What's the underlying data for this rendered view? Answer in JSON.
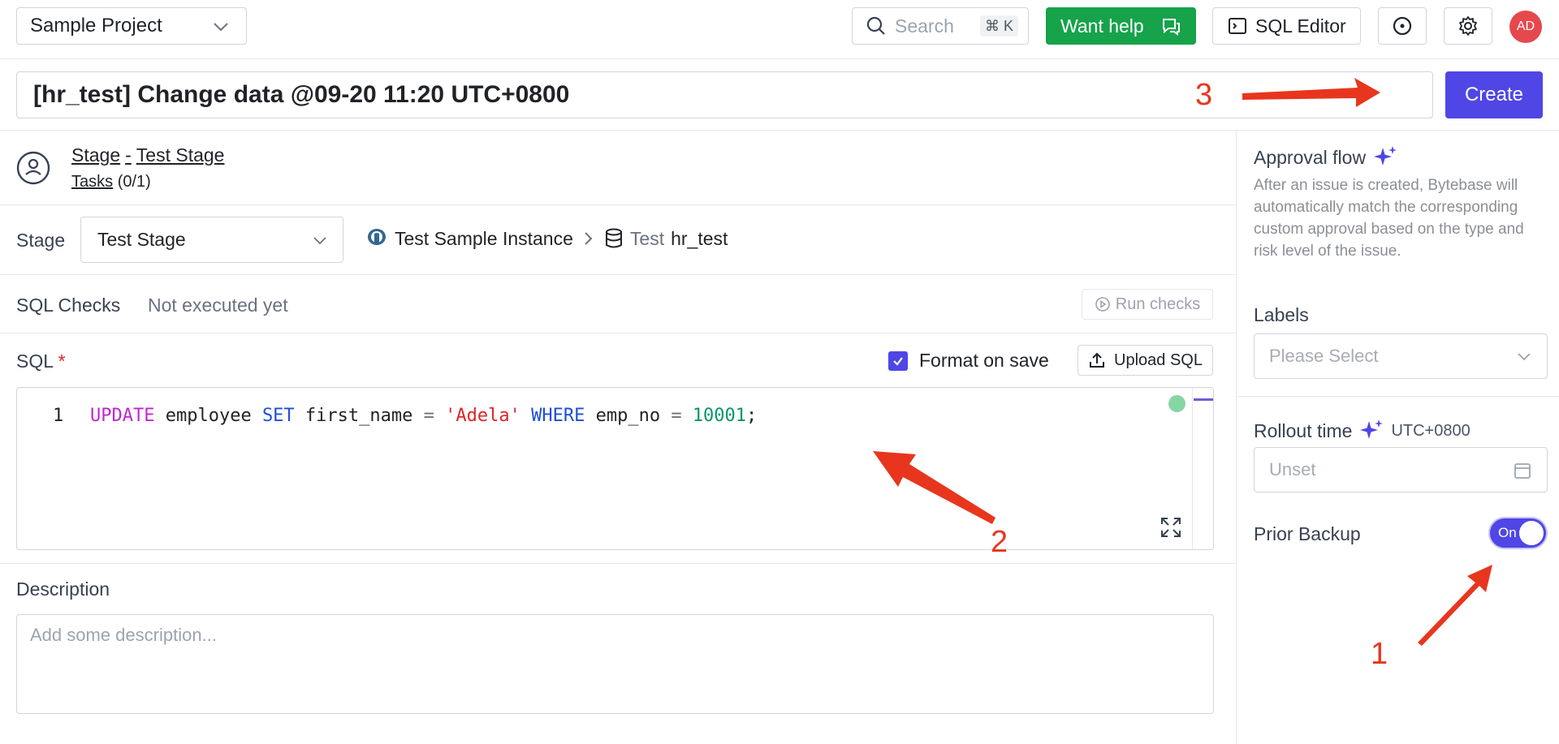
{
  "topbar": {
    "project": "Sample Project",
    "search_placeholder": "Search",
    "search_shortcut": "⌘ K",
    "help_label": "Want help",
    "sql_editor_label": "SQL Editor",
    "avatar_initials": "AD"
  },
  "issue": {
    "title": "[hr_test] Change data @09-20 11:20 UTC+0800",
    "create_label": "Create"
  },
  "stage_header": {
    "stage_word": "Stage",
    "separator": "-",
    "stage_name": "Test Stage",
    "tasks_word": "Tasks",
    "tasks_count": "(0/1)"
  },
  "stage_row": {
    "label": "Stage",
    "selected": "Test Stage",
    "instance": "Test Sample Instance",
    "env": "Test",
    "database": "hr_test"
  },
  "sql_checks": {
    "label": "SQL Checks",
    "status": "Not executed yet",
    "run_label": "Run checks"
  },
  "sql": {
    "label": "SQL",
    "required_mark": "*",
    "format_on_save_label": "Format on save",
    "format_on_save_checked": true,
    "upload_label": "Upload SQL",
    "line_number": "1",
    "tokens": {
      "t1": "UPDATE",
      "t2": " employee ",
      "t3": "SET",
      "t4": " first_name ",
      "t5": "=",
      "t6": " ",
      "t7": "'Adela'",
      "t8": " ",
      "t9": "WHERE",
      "t10": " emp_no ",
      "t11": "=",
      "t12": " ",
      "t13": "10001",
      "t14": ";"
    }
  },
  "description": {
    "label": "Description",
    "placeholder": "Add some description..."
  },
  "sidebar": {
    "approval_title": "Approval flow",
    "approval_desc": "After an issue is created, Bytebase will automatically match the corresponding custom approval based on the type and risk level of the issue.",
    "labels_title": "Labels",
    "labels_placeholder": "Please Select",
    "rollout_title": "Rollout time",
    "rollout_tz": "UTC+0800",
    "rollout_value": "Unset",
    "backup_title": "Prior Backup",
    "backup_toggle_label": "On",
    "backup_enabled": true
  },
  "annotations": {
    "a1": "1",
    "a2": "2",
    "a3": "3",
    "color": "#e8361e"
  },
  "colors": {
    "primary": "#4f46e5",
    "success": "#16a34a",
    "avatar": "#e5484d"
  }
}
